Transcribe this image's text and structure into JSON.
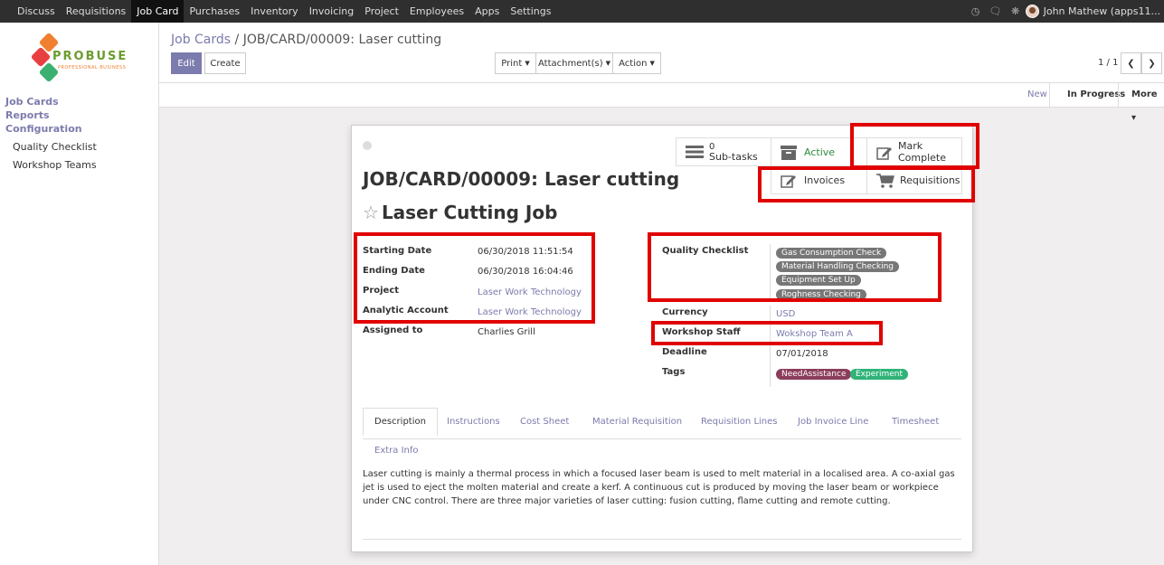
{
  "topbar": {
    "menu": [
      "Discuss",
      "Requisitions",
      "Job Card",
      "Purchases",
      "Inventory",
      "Invoicing",
      "Project",
      "Employees",
      "Apps",
      "Settings"
    ],
    "active_index": 2,
    "user_name": "John Mathew (apps11..."
  },
  "sidebar": {
    "logo_text": "PROBUSE",
    "logo_tagline": "PROFESSIONAL BUSINESS",
    "links": [
      "Job Cards",
      "Reports",
      "Configuration"
    ],
    "sub_links": [
      "Quality Checklist",
      "Workshop Teams"
    ]
  },
  "control": {
    "breadcrumb_parent": "Job Cards",
    "breadcrumb_sep": "/",
    "breadcrumb_current": "JOB/CARD/00009: Laser cutting",
    "edit_label": "Edit",
    "create_label": "Create",
    "print_label": "Print",
    "attachments_label": "Attachment(s)",
    "action_label": "Action",
    "pager_text": "1 / 1"
  },
  "statusbar": {
    "stages": [
      "New",
      "In Progress",
      "More"
    ],
    "current": "In Progress"
  },
  "form": {
    "subtasks_count": "0",
    "subtasks_label": "Sub-tasks",
    "active_label": "Active",
    "mark_complete_label": "Mark Complete",
    "invoices_label": "Invoices",
    "requisitions_label": "Requisitions",
    "reference": "JOB/CARD/00009: Laser cutting",
    "name": "Laser Cutting Job",
    "fields_left": [
      {
        "label": "Starting Date",
        "value": "06/30/2018 11:51:54"
      },
      {
        "label": "Ending Date",
        "value": "06/30/2018 16:04:46"
      },
      {
        "label": "Project",
        "value": "Laser Work Technology"
      },
      {
        "label": "Analytic Account",
        "value": "Laser Work Technology"
      },
      {
        "label": "Assigned to",
        "value": "Charlies Grill"
      }
    ],
    "quality_label": "Quality Checklist",
    "quality_tags": [
      "Gas Consumption Check",
      "Material Handling Checking",
      "Equipment Set Up",
      "Roghness Checking"
    ],
    "currency_label": "Currency",
    "currency_value": "USD",
    "workshop_label": "Workshop Staff",
    "workshop_value": "Wokshop Team A",
    "deadline_label": "Deadline",
    "deadline_value": "07/01/2018",
    "tags_label": "Tags",
    "tags": [
      {
        "label": "NeedAssistance",
        "color": "#8c3d5c"
      },
      {
        "label": "Experiment",
        "color": "#2fb377"
      }
    ],
    "tabs": [
      "Description",
      "Instructions",
      "Cost Sheet",
      "Material Requisition",
      "Requisition Lines",
      "Job Invoice Line",
      "Timesheet",
      "Extra Info"
    ],
    "description": "Laser cutting is mainly a thermal process in which a focused laser beam is used to melt material in a localised area. A co-axial gas jet is used to eject the molten material and create a kerf. A continuous cut is produced by moving the laser beam or workpiece under CNC control. There are three major varieties of laser cutting: fusion cutting, flame cutting and remote cutting."
  },
  "colors": {
    "accent": "#7c7bad",
    "highlight": "#e00000",
    "active_green": "#2e8b3e"
  }
}
